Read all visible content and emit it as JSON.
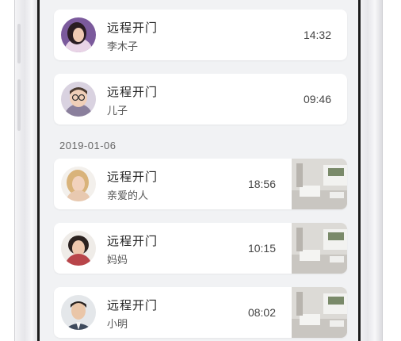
{
  "records": [
    {
      "title": "远程开门",
      "name": "李木子",
      "time": "14:32",
      "avatar": "woman-dark-hair-avatar",
      "has_snapshot": false
    },
    {
      "title": "远程开门",
      "name": "儿子",
      "time": "09:46",
      "avatar": "boy-glasses-avatar",
      "has_snapshot": false
    },
    {
      "title": "远程开门",
      "name": "亲爱的人",
      "time": "18:56",
      "avatar": "blonde-woman-avatar",
      "has_snapshot": true
    },
    {
      "title": "远程开门",
      "name": "妈妈",
      "time": "10:15",
      "avatar": "older-woman-avatar",
      "has_snapshot": true
    },
    {
      "title": "远程开门",
      "name": "小明",
      "time": "08:02",
      "avatar": "man-suit-avatar",
      "has_snapshot": true
    }
  ],
  "date_group": "2019-01-06",
  "colors": {
    "screen_bg": "#f1f2f4",
    "card_bg": "#ffffff",
    "title": "#222222",
    "subtitle": "#555555"
  }
}
